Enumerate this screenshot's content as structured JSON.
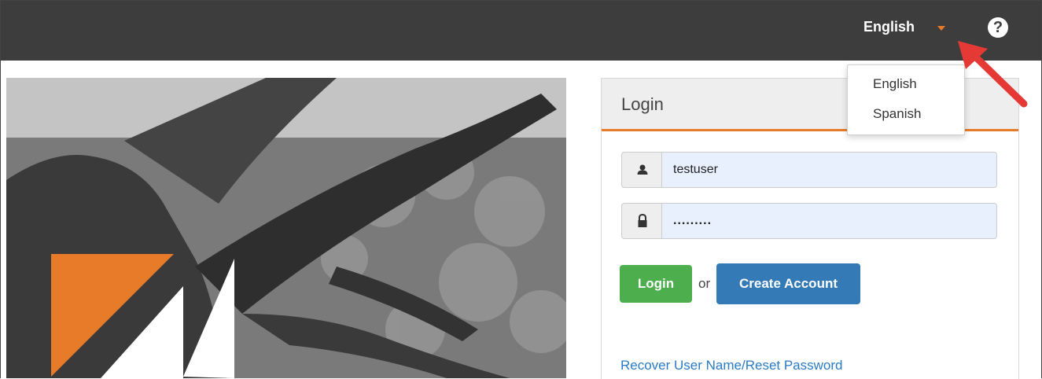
{
  "topbar": {
    "language_label": "English",
    "help_icon": "question-circle-icon"
  },
  "language_menu": {
    "items": [
      {
        "label": "English"
      },
      {
        "label": "Spanish"
      }
    ]
  },
  "login_panel": {
    "title": "Login",
    "username": {
      "icon": "user-icon",
      "value": "testuser"
    },
    "password": {
      "icon": "lock-icon",
      "value": "........."
    },
    "login_button": "Login",
    "or_text": "or",
    "create_account_button": "Create Account",
    "recover_link": "Recover User Name/Reset Password"
  },
  "colors": {
    "topbar": "#3d3d3d",
    "accent_orange": "#e87b2a",
    "login_green": "#4cae4c",
    "create_blue": "#337ab7",
    "annotation_arrow": "#e53935"
  }
}
